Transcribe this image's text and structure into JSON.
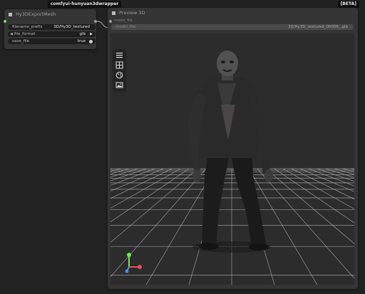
{
  "badges": {
    "package": "comfyui-hunyuan3dwrapper",
    "beta": "[BETA]"
  },
  "export_node": {
    "title": "Hy3DExportMesh",
    "widgets": [
      {
        "label": "filename_prefix",
        "value": "3D/Hy3D_textured"
      },
      {
        "label": "file_format",
        "value": "glb"
      },
      {
        "label": "save_file",
        "value": "true"
      }
    ]
  },
  "preview_node": {
    "title": "Preview 3D",
    "input_label": "model_file",
    "field_label": "model_file",
    "field_value": "3D/Hy3D_textured_00006_.glb"
  },
  "toolbar_icons": [
    "menu-icon",
    "grid-icon",
    "palette-icon",
    "image-icon"
  ],
  "colors": {
    "canvas_bg": "#222222",
    "node_bg": "#353535",
    "link_color": "#9a9a9a",
    "viewport_bg": "#2c2c2c",
    "axis_x": "#e84d5f",
    "axis_y": "#7ee06a",
    "axis_z": "#4f8fe8"
  }
}
